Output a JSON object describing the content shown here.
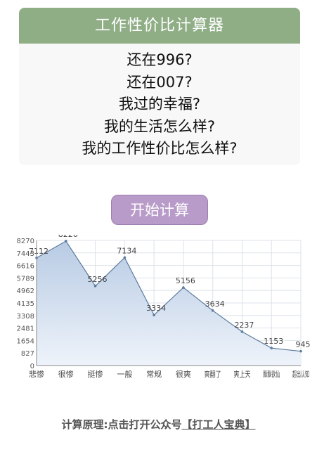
{
  "card": {
    "title": "工作性价比计算器",
    "questions": [
      "还在996?",
      "还在007?",
      "我过的幸福?",
      "我的生活怎么样?",
      "我的工作性价比怎么样?"
    ]
  },
  "start_button": {
    "label": "开始计算"
  },
  "chart_data": {
    "type": "area",
    "categories": [
      "悲惨",
      "很惨",
      "挺惨",
      "一般",
      "常规",
      "很爽",
      "爽翻了",
      "爽上天",
      "飘飘欲仙",
      "超出认知"
    ],
    "values": [
      7112,
      8226,
      5256,
      7134,
      3334,
      5156,
      3634,
      2237,
      1153,
      945
    ],
    "y_ticks": [
      0,
      827,
      1654,
      2481,
      3308,
      4135,
      4962,
      5789,
      6616,
      7443,
      8270
    ],
    "ylim": [
      0,
      8270
    ],
    "grid": true,
    "colors": {
      "line": "#5b7a9e",
      "fill_top": "#b8cbe4",
      "fill_bottom": "#eef3fa",
      "grid": "#dde2ea"
    }
  },
  "footer": {
    "prefix": "计算原理:点击打开公众号",
    "link": "【打工人宝典】"
  }
}
